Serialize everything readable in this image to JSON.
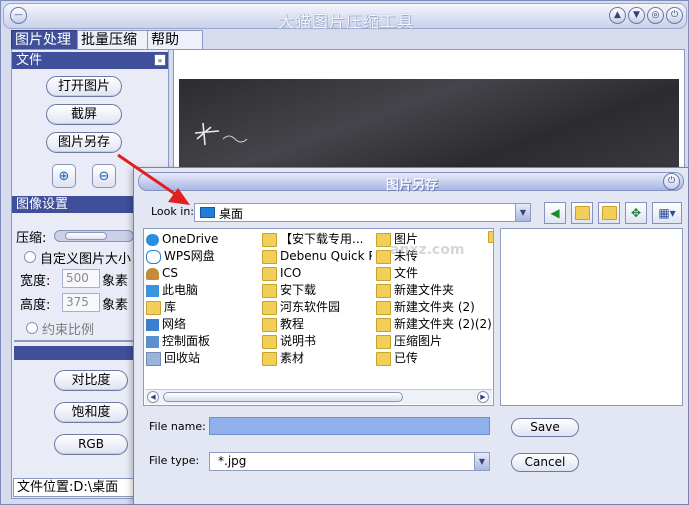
{
  "app": {
    "title": "大猫图片压缩工具"
  },
  "menu": [
    "图片处理",
    "批量压缩",
    "帮助"
  ],
  "left": {
    "file_section": "文件",
    "open_label": "打开图片",
    "screenshot_label": "截屏",
    "save_as_label": "图片另存",
    "image_settings": "图像设置",
    "compress_label": "压缩:",
    "custom_size_label": "自定义图片大小",
    "width_label": "宽度:",
    "width_value": "500",
    "width_unit": "象素",
    "height_label": "高度:",
    "height_value": "375",
    "height_unit": "象素",
    "constrain_label": "约束比例",
    "contrast_label": "对比度",
    "saturation_label": "饱和度",
    "rgb_label": "RGB",
    "status": "文件位置:D:\\桌面"
  },
  "dialog": {
    "title": "图片另存",
    "look_in_label": "Look in:",
    "look_in_value": "桌面",
    "col1": [
      "OneDrive",
      "WPS网盘",
      "CS",
      "此电脑",
      "库",
      "网络",
      "控制面板",
      "回收站"
    ],
    "col2": [
      "【安下载专用...",
      "Debenu Quick PD...",
      "ICO",
      "安下载",
      "河东软件园",
      "教程",
      "说明书",
      "素材"
    ],
    "col3": [
      "图片",
      "未传",
      "文件",
      "新建文件夹",
      "新建文件夹 (2)",
      "新建文件夹 (2)(2)",
      "压缩图片",
      "已传"
    ],
    "file_name_label": "File name:",
    "file_name_value": "",
    "file_type_label": "File type:",
    "file_type_value": "*.jpg",
    "save_label": "Save",
    "cancel_label": "Cancel"
  },
  "watermark": "anxz.com",
  "colors": {
    "accent": "#3f4f9a",
    "arrow": "#e02020"
  }
}
